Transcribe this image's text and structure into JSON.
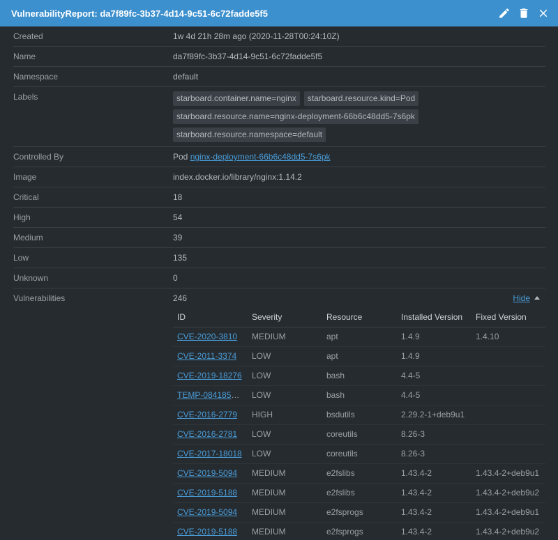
{
  "header": {
    "title": "VulnerabilityReport: da7f89fc-3b37-4d14-9c51-6c72fadde5f5"
  },
  "details": {
    "created": {
      "label": "Created",
      "value": "1w 4d 21h 28m ago (2020-11-28T00:24:10Z)"
    },
    "name": {
      "label": "Name",
      "value": "da7f89fc-3b37-4d14-9c51-6c72fadde5f5"
    },
    "namespace": {
      "label": "Namespace",
      "value": "default"
    },
    "labels": {
      "label": "Labels",
      "items": [
        "starboard.container.name=nginx",
        "starboard.resource.kind=Pod",
        "starboard.resource.name=nginx-deployment-66b6c48dd5-7s6pk",
        "starboard.resource.namespace=default"
      ]
    },
    "controlled_by": {
      "label": "Controlled By",
      "kind": "Pod",
      "link": "nginx-deployment-66b6c48dd5-7s6pk"
    },
    "image": {
      "label": "Image",
      "value": "index.docker.io/library/nginx:1.14.2"
    },
    "critical": {
      "label": "Critical",
      "value": "18"
    },
    "high": {
      "label": "High",
      "value": "54"
    },
    "medium": {
      "label": "Medium",
      "value": "39"
    },
    "low": {
      "label": "Low",
      "value": "135"
    },
    "unknown": {
      "label": "Unknown",
      "value": "0"
    },
    "vulnerabilities": {
      "label": "Vulnerabilities",
      "value": "246",
      "toggle_label": "Hide"
    }
  },
  "table": {
    "columns": [
      "ID",
      "Severity",
      "Resource",
      "Installed Version",
      "Fixed Version"
    ],
    "rows": [
      {
        "id": "CVE-2020-3810",
        "severity": "MEDIUM",
        "resource": "apt",
        "installed": "1.4.9",
        "fixed": "1.4.10"
      },
      {
        "id": "CVE-2011-3374",
        "severity": "LOW",
        "resource": "apt",
        "installed": "1.4.9",
        "fixed": ""
      },
      {
        "id": "CVE-2019-18276",
        "severity": "LOW",
        "resource": "bash",
        "installed": "4.4-5",
        "fixed": ""
      },
      {
        "id": "TEMP-0841856…",
        "severity": "LOW",
        "resource": "bash",
        "installed": "4.4-5",
        "fixed": ""
      },
      {
        "id": "CVE-2016-2779",
        "severity": "HIGH",
        "resource": "bsdutils",
        "installed": "2.29.2-1+deb9u1",
        "fixed": ""
      },
      {
        "id": "CVE-2016-2781",
        "severity": "LOW",
        "resource": "coreutils",
        "installed": "8.26-3",
        "fixed": ""
      },
      {
        "id": "CVE-2017-18018",
        "severity": "LOW",
        "resource": "coreutils",
        "installed": "8.26-3",
        "fixed": ""
      },
      {
        "id": "CVE-2019-5094",
        "severity": "MEDIUM",
        "resource": "e2fslibs",
        "installed": "1.43.4-2",
        "fixed": "1.43.4-2+deb9u1"
      },
      {
        "id": "CVE-2019-5188",
        "severity": "MEDIUM",
        "resource": "e2fslibs",
        "installed": "1.43.4-2",
        "fixed": "1.43.4-2+deb9u2"
      },
      {
        "id": "CVE-2019-5094",
        "severity": "MEDIUM",
        "resource": "e2fsprogs",
        "installed": "1.43.4-2",
        "fixed": "1.43.4-2+deb9u1"
      },
      {
        "id": "CVE-2019-5188",
        "severity": "MEDIUM",
        "resource": "e2fsprogs",
        "installed": "1.43.4-2",
        "fixed": "1.43.4-2+deb9u2"
      }
    ]
  },
  "icons": {
    "edit": "pencil-icon",
    "delete": "trash-icon",
    "close": "close-icon"
  },
  "colors": {
    "header_bg": "#3d90ce",
    "body_bg": "#262b2f",
    "link": "#4a9edb"
  }
}
